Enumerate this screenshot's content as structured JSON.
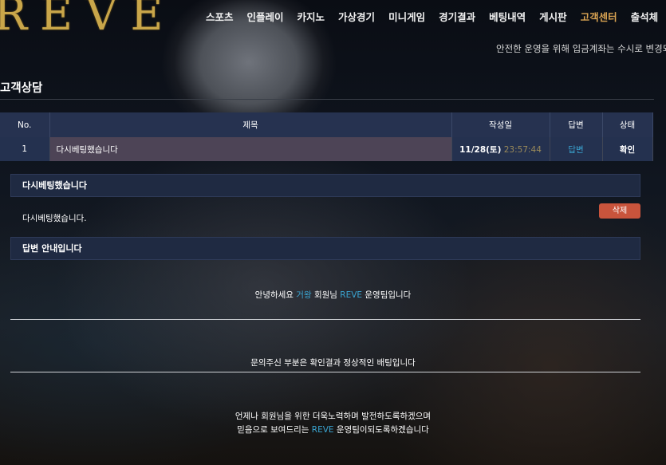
{
  "brand": {
    "logo_text": "REVE"
  },
  "nav": {
    "items": [
      {
        "label": "스포츠"
      },
      {
        "label": "인플레이"
      },
      {
        "label": "카지노"
      },
      {
        "label": "가상경기"
      },
      {
        "label": "미니게임"
      },
      {
        "label": "경기결과"
      },
      {
        "label": "베팅내역"
      },
      {
        "label": "게시판"
      },
      {
        "label": "고객센터",
        "active": true
      },
      {
        "label": "출석체"
      }
    ]
  },
  "ticker": {
    "text": "안전한 운영을 위해 입금계좌는 수시로 변경되"
  },
  "page": {
    "title": "고객상담"
  },
  "table": {
    "headers": {
      "no": "No.",
      "subject": "제목",
      "date": "작성일",
      "answer": "답변",
      "status": "상태"
    },
    "rows": [
      {
        "no": "1",
        "subject": "다시베팅했습니다",
        "date": "11/28(토)",
        "time": "23:57:44",
        "answer": "답변",
        "status": "확인"
      }
    ]
  },
  "question": {
    "title": "다시베팅했습니다",
    "body": "다시베팅했습니다.",
    "delete_label": "삭제"
  },
  "reply": {
    "title": "답변 안내입니다",
    "greeting_pre": "안녕하세요 ",
    "greeting_name": "거왕",
    "greeting_mid": " 회원님 ",
    "greeting_brand": "REVE",
    "greeting_post": " 운영팀입니다",
    "answer": "문의주신 부분은 확인결과 정상적인 배팅입니다",
    "closing_1": "언제나 회원님을 위한 더욱노력하며 발전하도록하겠으며",
    "closing_2_pre": "믿음으로 보여드리는 ",
    "closing_2_brand": "REVE",
    "closing_2_post": " 운영팀이되도록하겠습니다"
  },
  "colors": {
    "accent_gold": "#c9a64a",
    "nav_active": "#d9a352",
    "link_blue": "#3aa5d2",
    "delete_red": "#c9543c",
    "header_navy": "#263250"
  }
}
